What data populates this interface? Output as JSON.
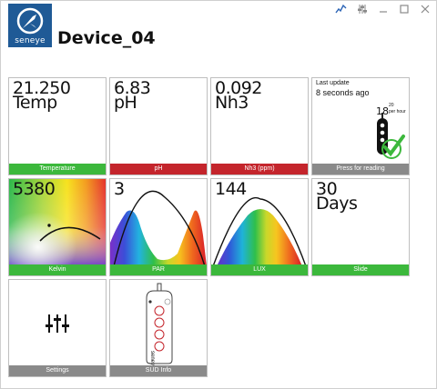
{
  "window": {
    "device_name": "Device_04",
    "logo_text": "seneye"
  },
  "tiles": {
    "temperature": {
      "value": "21.250",
      "unit": "Temp",
      "label": "Temperature",
      "status_color": "#3cb83c"
    },
    "ph": {
      "value": "6.83",
      "unit": "pH",
      "label": "pH",
      "status_color": "#c4252c"
    },
    "nh3": {
      "value": "0.092",
      "unit": "Nh3",
      "label": "Nh3 (ppm)",
      "status_color": "#c4252c"
    },
    "reading": {
      "title": "Last update",
      "time": "8 seconds ago",
      "rate_value": "18",
      "rate_max": "20",
      "rate_unit": "per hour",
      "label": "Press for reading",
      "status_color": "#8a8a8a"
    },
    "kelvin": {
      "value": "5380",
      "label": "Kelvin",
      "status_color": "#3cb83c"
    },
    "par": {
      "value": "3",
      "label": "PAR",
      "status_color": "#3cb83c"
    },
    "lux": {
      "value": "144",
      "label": "LUX",
      "status_color": "#3cb83c"
    },
    "slide": {
      "value": "30",
      "unit": "Days",
      "label": "Slide",
      "status_color": "#3cb83c"
    },
    "settings": {
      "label": "Settings"
    },
    "sud": {
      "label": "SUD Info",
      "brand": "seneye"
    }
  }
}
